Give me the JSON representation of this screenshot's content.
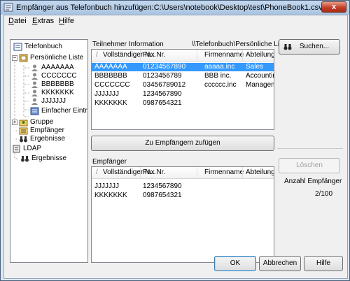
{
  "window": {
    "title": "Empfänger aus Telefonbuch hinzufügen:C:\\Users\\notebook\\Desktop\\test\\PhoneBook1.csv",
    "close_glyph": "x"
  },
  "menu": [
    {
      "key": "D",
      "rest": "atei"
    },
    {
      "key": "E",
      "rest": "xtras"
    },
    {
      "key": "H",
      "rest": "ilfe"
    }
  ],
  "tree": {
    "telefonbuch": "Telefonbuch",
    "persoenliche_liste": "Persönliche Liste",
    "contacts": [
      "AAAAAAA",
      "CCCCCCC",
      "BBBBBBB",
      "KKKKKKK",
      "JJJJJJJ"
    ],
    "einfacher_eintrag": "Einfacher Eintrag",
    "gruppe": "Gruppe",
    "empfaenger": "Empfänger",
    "ergebnisse1": "Ergebnisse",
    "ldap": "LDAP",
    "ergebnisse2": "Ergebnisse"
  },
  "info_panel": {
    "label": "Teilnehmer Information",
    "path": "\\\\Telefonbuch\\Persönliche Liste",
    "columns": [
      "Vollständiger N...",
      "Fax Nr.",
      "Firmenname",
      "Abteilung"
    ],
    "rows": [
      [
        "AAAAAAA",
        "01234567890",
        "aaaaa.inc",
        "Sales"
      ],
      [
        "BBBBBBB",
        "0123456789",
        "BBB inc.",
        "Accounting"
      ],
      [
        "CCCCCCC",
        "03456789012",
        "cccccc.inc",
        "Management"
      ],
      [
        "JJJJJJJ",
        "1234567890",
        "",
        ""
      ],
      [
        "KKKKKKK",
        "0987654321",
        "",
        ""
      ]
    ]
  },
  "add_button": "Zu Empfängern zufügen",
  "recipients_panel": {
    "label": "Empfänger",
    "columns": [
      "Vollständiger N...",
      "Fax Nr.",
      "Firmenname",
      "Abteilung"
    ],
    "rows": [
      [
        "JJJJJJJ",
        "1234567890",
        "",
        ""
      ],
      [
        "KKKKKKK",
        "0987654321",
        "",
        ""
      ]
    ]
  },
  "right_panel": {
    "search": "Suchen...",
    "delete": "Löschen",
    "count_label": "Anzahl Empfänger",
    "count_value": "2/100"
  },
  "footer": {
    "ok": "OK",
    "cancel": "Abbrechen",
    "help": "Hilfe"
  },
  "colors": {
    "selection": "#3399ff",
    "accent": "#3c7fb1"
  }
}
